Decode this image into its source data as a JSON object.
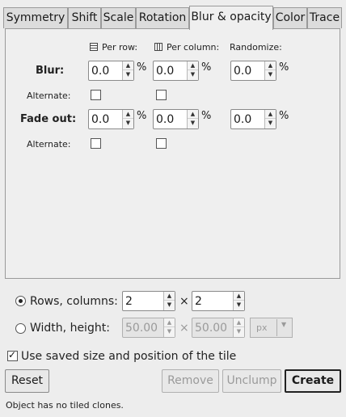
{
  "tabs": [
    {
      "label": "Symmetry",
      "active": false
    },
    {
      "label": "Shift",
      "active": false
    },
    {
      "label": "Scale",
      "active": false
    },
    {
      "label": "Rotation",
      "active": false
    },
    {
      "label": "Blur & opacity",
      "active": true
    },
    {
      "label": "Color",
      "active": false
    },
    {
      "label": "Trace",
      "active": false
    }
  ],
  "headers": {
    "per_row": "Per row:",
    "per_column": "Per column:",
    "randomize": "Randomize:"
  },
  "blur": {
    "label": "Blur:",
    "per_row": "0.0",
    "per_column": "0.0",
    "randomize": "0.0",
    "unit": "%",
    "alternate_label": "Alternate:"
  },
  "fade": {
    "label": "Fade out:",
    "per_row": "0.0",
    "per_column": "0.0",
    "randomize": "0.0",
    "unit": "%",
    "alternate_label": "Alternate:"
  },
  "layout": {
    "rows_columns_label": "Rows, columns:",
    "rows": "2",
    "columns": "2",
    "times": "×",
    "width_height_label": "Width, height:",
    "width": "50.00",
    "height": "50.00",
    "unit": "px",
    "rows_columns_selected": true
  },
  "use_saved": {
    "label": "Use saved size and position of the tile",
    "checked": true
  },
  "buttons": {
    "reset": "Reset",
    "remove": "Remove",
    "unclump": "Unclump",
    "create": "Create"
  },
  "status": "Object has no tiled clones."
}
